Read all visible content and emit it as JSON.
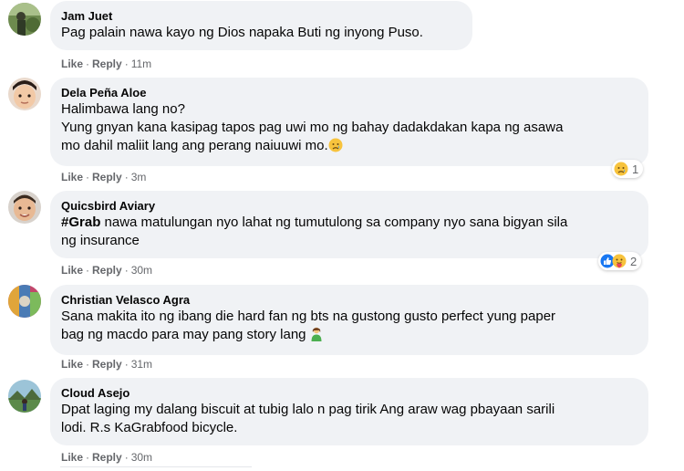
{
  "colors": {
    "bubble": "#f0f2f5",
    "meta_text": "#65676b",
    "main_text": "#050505",
    "like_blue": "#1877f2",
    "emoji_yellow": "#f7c33d"
  },
  "actions": {
    "like_label": "Like",
    "reply_label": "Reply",
    "separator": "·"
  },
  "comments": [
    {
      "author": "Jam Juet",
      "text": "Pag palain nawa kayo ng Dios napaka Buti ng inyong Puso.",
      "time": "11m",
      "avatar_icon": "avatar-photo-outdoor"
    },
    {
      "author": "Dela Peña Aloe",
      "text": "Halimbawa lang no?\nYung gnyan kana kasipag tapos pag uwi mo ng bahay dadakdakan kapa ng asawa\nmo dahil maliit lang ang perang naiuuwi mo.",
      "time": "3m",
      "avatar_icon": "avatar-photo-child",
      "inline_emoji": "sad-tear-emoji",
      "reactions": {
        "icons": [
          "sad-reaction-icon"
        ],
        "count": "1"
      }
    },
    {
      "author": "Quicsbird Aviary",
      "hashtag": "#Grab",
      "text": " nawa matulungan nyo lahat ng tumutulong sa company nyo sana bigyan sila\nng insurance",
      "time": "30m",
      "avatar_icon": "avatar-photo-child",
      "reactions": {
        "icons": [
          "like-reaction-icon",
          "care-reaction-icon"
        ],
        "count": "2"
      }
    },
    {
      "author": "Christian Velasco Agra",
      "text": "Sana makita ito ng ibang die hard fan ng bts na gustong gusto perfect yung paper\nbag ng macdo para may pang story lang",
      "time": "31m",
      "avatar_icon": "avatar-photo-colorful",
      "inline_emoji": "person-emoji"
    },
    {
      "author": "Cloud Asejo",
      "text": "Dpat laging my dalang biscuit at tubig lalo n pag tirik Ang araw wag pbayaan sarili\nlodi. R.s KaGrabfood bicycle.",
      "time": "30m",
      "avatar_icon": "avatar-photo-landscape"
    }
  ]
}
